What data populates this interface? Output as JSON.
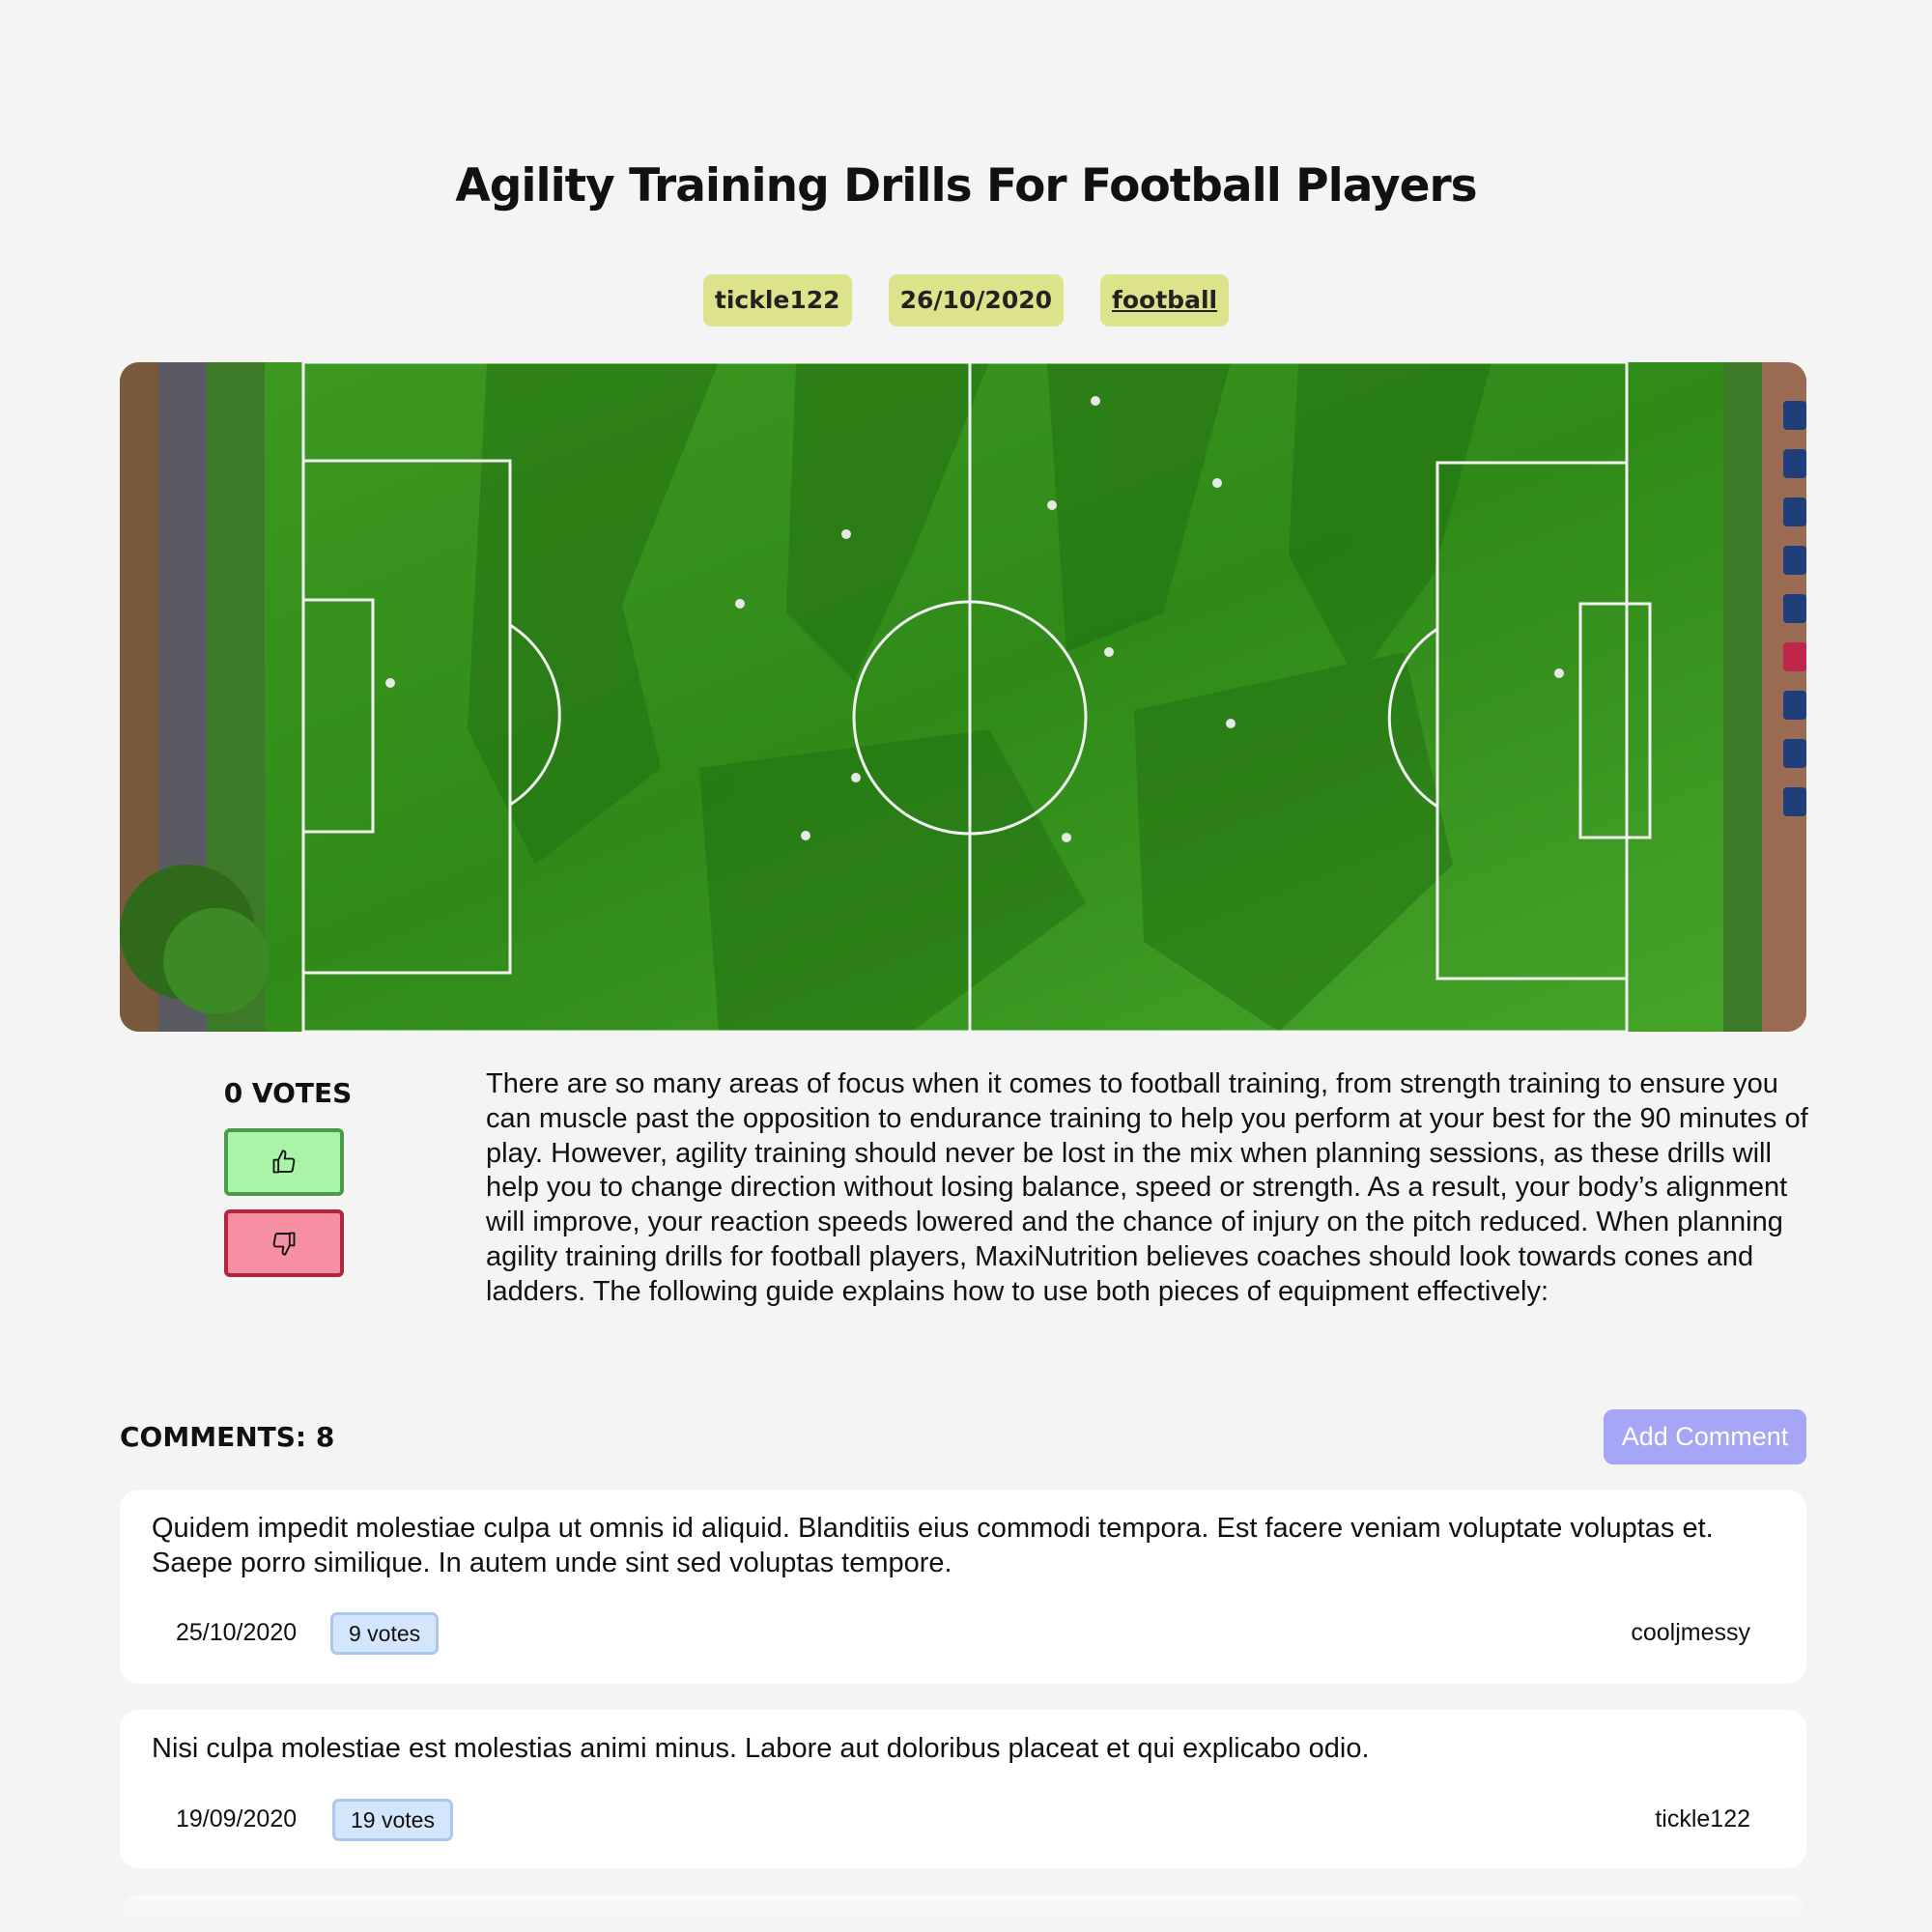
{
  "post": {
    "title": "Agility Training Drills For Football Players",
    "author": "tickle122",
    "date": "26/10/2020",
    "topic": "football",
    "votes_label": "0 VOTES",
    "body": "There are so many areas of focus when it comes to football training, from strength training to ensure you can muscle past the opposition to endurance training to help you perform at your best for the 90 minutes of play. However, agility training should never be lost in the mix when planning sessions, as these drills will help you to change direction without losing balance, speed or strength. As a result, your body’s alignment will improve, your reaction speeds lowered and the chance of injury on the pitch reduced. When planning agility training drills for football players, MaxiNutrition believes coaches should look towards cones and ladders. The following guide explains how to use both pieces of equipment effectively:"
  },
  "vote_buttons": {
    "up_icon": "thumbs-up-icon",
    "down_icon": "thumbs-down-icon"
  },
  "comments_section": {
    "count_label": "COMMENTS: 8",
    "add_button_label": "Add Comment"
  },
  "comments": [
    {
      "text": "Quidem impedit molestiae culpa ut omnis id aliquid. Blanditiis eius commodi tempora. Est facere veniam voluptate voluptas et. Saepe porro similique. In autem unde sint sed voluptas tempore.",
      "date": "25/10/2020",
      "votes": "9 votes",
      "author": "cooljmessy"
    },
    {
      "text": "Nisi culpa molestiae est molestias animi minus. Labore aut doloribus placeat et qui explicabo odio.",
      "date": "19/09/2020",
      "votes": "19 votes",
      "author": "tickle122"
    }
  ],
  "colors": {
    "chip": "#dde38a",
    "upvote": "#a8f5a8",
    "downvote": "#f78fa3",
    "add_button": "#a5a6f6",
    "vote_badge": "#d4e6fb"
  }
}
